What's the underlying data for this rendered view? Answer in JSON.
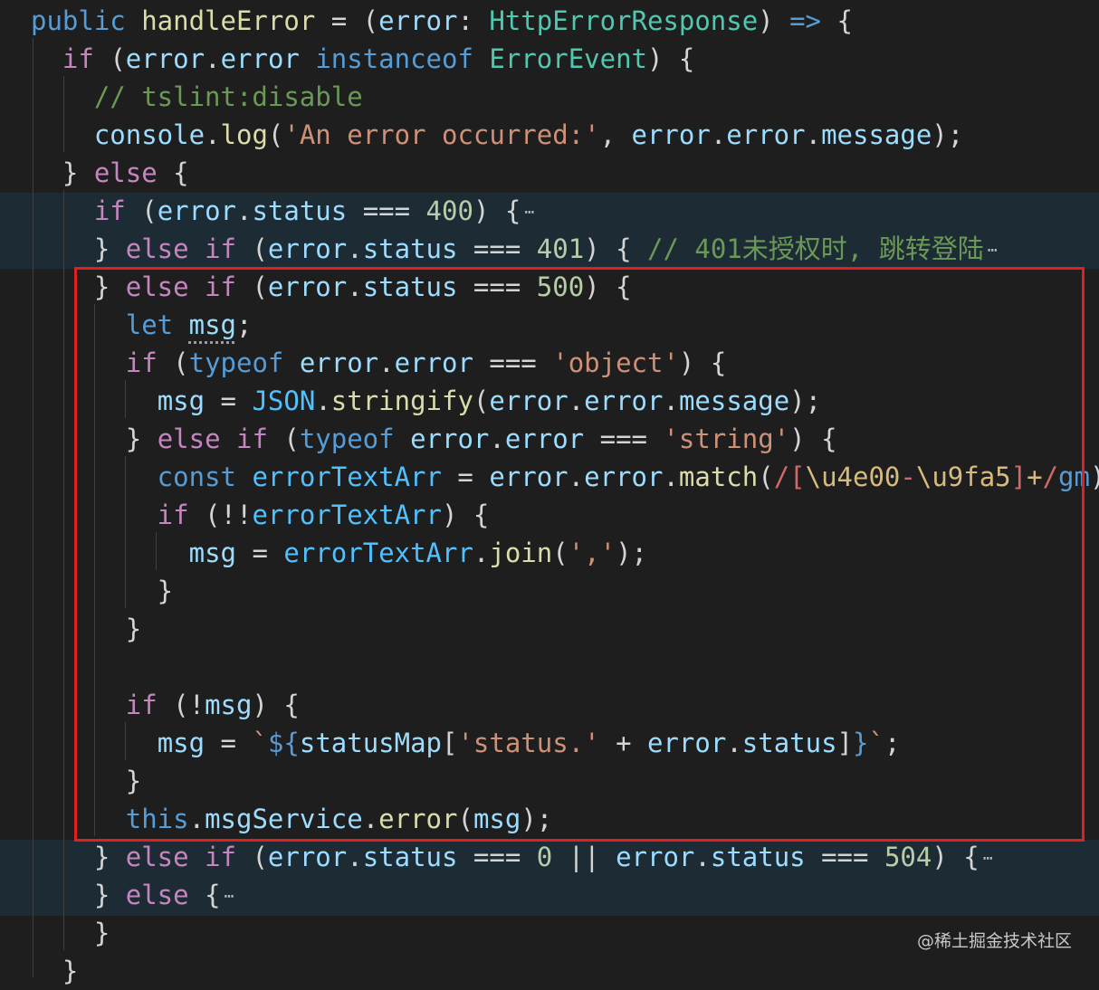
{
  "colors": {
    "background": "#1e1e1e",
    "highlight_band": "#1d2b35",
    "selection_box": "#e02020"
  },
  "code": {
    "lines": [
      [
        {
          "t": "public ",
          "c": "kw"
        },
        {
          "t": "handleError",
          "c": "fn"
        },
        {
          "t": " = (",
          "c": "op"
        },
        {
          "t": "error",
          "c": "var"
        },
        {
          "t": ": ",
          "c": "op"
        },
        {
          "t": "HttpErrorResponse",
          "c": "typ"
        },
        {
          "t": ") ",
          "c": "op"
        },
        {
          "t": "=>",
          "c": "kw"
        },
        {
          "t": " {",
          "c": "op"
        }
      ],
      [
        {
          "t": "  if ",
          "c": "ctl"
        },
        {
          "t": "(",
          "c": "op"
        },
        {
          "t": "error",
          "c": "var"
        },
        {
          "t": ".",
          "c": "op"
        },
        {
          "t": "error",
          "c": "var"
        },
        {
          "t": " ",
          "c": "op"
        },
        {
          "t": "instanceof ",
          "c": "kw"
        },
        {
          "t": "ErrorEvent",
          "c": "typ"
        },
        {
          "t": ") {",
          "c": "op"
        }
      ],
      [
        {
          "t": "    // tslint:disable",
          "c": "cmt"
        }
      ],
      [
        {
          "t": "    ",
          "c": "op"
        },
        {
          "t": "console",
          "c": "var"
        },
        {
          "t": ".",
          "c": "op"
        },
        {
          "t": "log",
          "c": "fn"
        },
        {
          "t": "(",
          "c": "op"
        },
        {
          "t": "'An error occurred:'",
          "c": "str"
        },
        {
          "t": ", ",
          "c": "op"
        },
        {
          "t": "error",
          "c": "var"
        },
        {
          "t": ".",
          "c": "op"
        },
        {
          "t": "error",
          "c": "var"
        },
        {
          "t": ".",
          "c": "op"
        },
        {
          "t": "message",
          "c": "var"
        },
        {
          "t": ");",
          "c": "op"
        }
      ],
      [
        {
          "t": "  } ",
          "c": "op"
        },
        {
          "t": "else",
          "c": "ctl"
        },
        {
          "t": " {",
          "c": "op"
        }
      ],
      [
        {
          "t": "    if ",
          "c": "ctl"
        },
        {
          "t": "(",
          "c": "op"
        },
        {
          "t": "error",
          "c": "var"
        },
        {
          "t": ".",
          "c": "op"
        },
        {
          "t": "status",
          "c": "var"
        },
        {
          "t": " === ",
          "c": "op"
        },
        {
          "t": "400",
          "c": "num"
        },
        {
          "t": ") {",
          "c": "op"
        },
        {
          "t": "⋯",
          "c": "fold"
        }
      ],
      [
        {
          "t": "    } ",
          "c": "op"
        },
        {
          "t": "else if ",
          "c": "ctl"
        },
        {
          "t": "(",
          "c": "op"
        },
        {
          "t": "error",
          "c": "var"
        },
        {
          "t": ".",
          "c": "op"
        },
        {
          "t": "status",
          "c": "var"
        },
        {
          "t": " === ",
          "c": "op"
        },
        {
          "t": "401",
          "c": "num"
        },
        {
          "t": ") { ",
          "c": "op"
        },
        {
          "t": "// 401未授权时, 跳转登陆",
          "c": "cmt"
        },
        {
          "t": "⋯",
          "c": "fold"
        }
      ],
      [
        {
          "t": "    } ",
          "c": "op"
        },
        {
          "t": "else if ",
          "c": "ctl"
        },
        {
          "t": "(",
          "c": "op"
        },
        {
          "t": "error",
          "c": "var"
        },
        {
          "t": ".",
          "c": "op"
        },
        {
          "t": "status",
          "c": "var"
        },
        {
          "t": " === ",
          "c": "op"
        },
        {
          "t": "500",
          "c": "num"
        },
        {
          "t": ") {",
          "c": "op"
        }
      ],
      [
        {
          "t": "      let ",
          "c": "kw"
        },
        {
          "t": "msg",
          "c": "var squiggle"
        },
        {
          "t": ";",
          "c": "op"
        }
      ],
      [
        {
          "t": "      if ",
          "c": "ctl"
        },
        {
          "t": "(",
          "c": "op"
        },
        {
          "t": "typeof ",
          "c": "kw"
        },
        {
          "t": "error",
          "c": "var"
        },
        {
          "t": ".",
          "c": "op"
        },
        {
          "t": "error",
          "c": "var"
        },
        {
          "t": " === ",
          "c": "op"
        },
        {
          "t": "'object'",
          "c": "str"
        },
        {
          "t": ") {",
          "c": "op"
        }
      ],
      [
        {
          "t": "        ",
          "c": "op"
        },
        {
          "t": "msg",
          "c": "var"
        },
        {
          "t": " = ",
          "c": "op"
        },
        {
          "t": "JSON",
          "c": "cst"
        },
        {
          "t": ".",
          "c": "op"
        },
        {
          "t": "stringify",
          "c": "fn"
        },
        {
          "t": "(",
          "c": "op"
        },
        {
          "t": "error",
          "c": "var"
        },
        {
          "t": ".",
          "c": "op"
        },
        {
          "t": "error",
          "c": "var"
        },
        {
          "t": ".",
          "c": "op"
        },
        {
          "t": "message",
          "c": "var"
        },
        {
          "t": ");",
          "c": "op"
        }
      ],
      [
        {
          "t": "      } ",
          "c": "op"
        },
        {
          "t": "else if ",
          "c": "ctl"
        },
        {
          "t": "(",
          "c": "op"
        },
        {
          "t": "typeof ",
          "c": "kw"
        },
        {
          "t": "error",
          "c": "var"
        },
        {
          "t": ".",
          "c": "op"
        },
        {
          "t": "error",
          "c": "var"
        },
        {
          "t": " === ",
          "c": "op"
        },
        {
          "t": "'string'",
          "c": "str"
        },
        {
          "t": ") {",
          "c": "op"
        }
      ],
      [
        {
          "t": "        const ",
          "c": "kw"
        },
        {
          "t": "errorTextArr",
          "c": "cst"
        },
        {
          "t": " = ",
          "c": "op"
        },
        {
          "t": "error",
          "c": "var"
        },
        {
          "t": ".",
          "c": "op"
        },
        {
          "t": "error",
          "c": "var"
        },
        {
          "t": ".",
          "c": "op"
        },
        {
          "t": "match",
          "c": "fn"
        },
        {
          "t": "(",
          "c": "op"
        },
        {
          "t": "/",
          "c": "rx"
        },
        {
          "t": "[",
          "c": "rx"
        },
        {
          "t": "\\u4e00",
          "c": "esc"
        },
        {
          "t": "-",
          "c": "rx"
        },
        {
          "t": "\\u9fa5",
          "c": "esc"
        },
        {
          "t": "]",
          "c": "rx"
        },
        {
          "t": "+",
          "c": "esc"
        },
        {
          "t": "/",
          "c": "rx"
        },
        {
          "t": "gm",
          "c": "kw"
        },
        {
          "t": ");",
          "c": "op"
        }
      ],
      [
        {
          "t": "        if ",
          "c": "ctl"
        },
        {
          "t": "(!!",
          "c": "op"
        },
        {
          "t": "errorTextArr",
          "c": "cst"
        },
        {
          "t": ") {",
          "c": "op"
        }
      ],
      [
        {
          "t": "          ",
          "c": "op"
        },
        {
          "t": "msg",
          "c": "var"
        },
        {
          "t": " = ",
          "c": "op"
        },
        {
          "t": "errorTextArr",
          "c": "cst"
        },
        {
          "t": ".",
          "c": "op"
        },
        {
          "t": "join",
          "c": "fn"
        },
        {
          "t": "(",
          "c": "op"
        },
        {
          "t": "','",
          "c": "str"
        },
        {
          "t": ");",
          "c": "op"
        }
      ],
      [
        {
          "t": "        }",
          "c": "op"
        }
      ],
      [
        {
          "t": "      }",
          "c": "op"
        }
      ],
      [
        {
          "t": "",
          "c": "op"
        }
      ],
      [
        {
          "t": "      if ",
          "c": "ctl"
        },
        {
          "t": "(!",
          "c": "op"
        },
        {
          "t": "msg",
          "c": "var"
        },
        {
          "t": ") {",
          "c": "op"
        }
      ],
      [
        {
          "t": "        ",
          "c": "op"
        },
        {
          "t": "msg",
          "c": "var"
        },
        {
          "t": " = ",
          "c": "op"
        },
        {
          "t": "`",
          "c": "str"
        },
        {
          "t": "${",
          "c": "kw"
        },
        {
          "t": "statusMap",
          "c": "var"
        },
        {
          "t": "[",
          "c": "op"
        },
        {
          "t": "'status.'",
          "c": "str"
        },
        {
          "t": " + ",
          "c": "op"
        },
        {
          "t": "error",
          "c": "var"
        },
        {
          "t": ".",
          "c": "op"
        },
        {
          "t": "status",
          "c": "var"
        },
        {
          "t": "]",
          "c": "op"
        },
        {
          "t": "}",
          "c": "kw"
        },
        {
          "t": "`",
          "c": "str"
        },
        {
          "t": ";",
          "c": "op"
        }
      ],
      [
        {
          "t": "      }",
          "c": "op"
        }
      ],
      [
        {
          "t": "      this",
          "c": "kw"
        },
        {
          "t": ".",
          "c": "op"
        },
        {
          "t": "msgService",
          "c": "var"
        },
        {
          "t": ".",
          "c": "op"
        },
        {
          "t": "error",
          "c": "fn"
        },
        {
          "t": "(",
          "c": "op"
        },
        {
          "t": "msg",
          "c": "var"
        },
        {
          "t": ");",
          "c": "op"
        }
      ],
      [
        {
          "t": "    } ",
          "c": "op"
        },
        {
          "t": "else if ",
          "c": "ctl"
        },
        {
          "t": "(",
          "c": "op"
        },
        {
          "t": "error",
          "c": "var"
        },
        {
          "t": ".",
          "c": "op"
        },
        {
          "t": "status",
          "c": "var"
        },
        {
          "t": " === ",
          "c": "op"
        },
        {
          "t": "0",
          "c": "num"
        },
        {
          "t": " || ",
          "c": "op"
        },
        {
          "t": "error",
          "c": "var"
        },
        {
          "t": ".",
          "c": "op"
        },
        {
          "t": "status",
          "c": "var"
        },
        {
          "t": " === ",
          "c": "op"
        },
        {
          "t": "504",
          "c": "num"
        },
        {
          "t": ") {",
          "c": "op"
        },
        {
          "t": "⋯",
          "c": "fold"
        }
      ],
      [
        {
          "t": "    } ",
          "c": "op"
        },
        {
          "t": "else",
          "c": "ctl"
        },
        {
          "t": " {",
          "c": "op"
        },
        {
          "t": "⋯",
          "c": "fold"
        }
      ],
      [
        {
          "t": "    }",
          "c": "op"
        }
      ],
      [
        {
          "t": "  }",
          "c": "op"
        }
      ]
    ]
  },
  "watermark": "@稀土掘金技术社区"
}
